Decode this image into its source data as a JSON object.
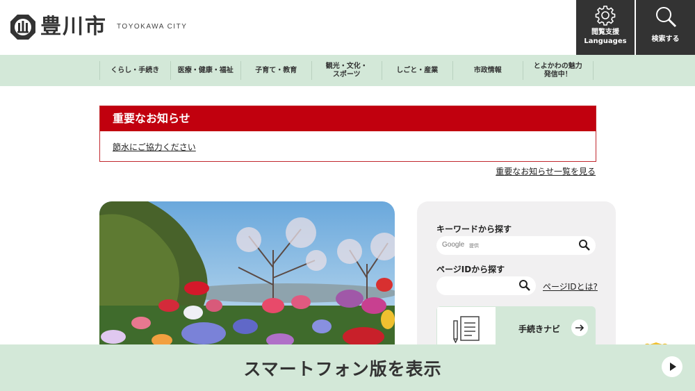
{
  "header": {
    "logo_title": "豊川市",
    "logo_subtitle": "TOYOKAWA CITY",
    "access_label_1": "閲覧支援",
    "access_label_2": "Languages",
    "search_label": "検索する"
  },
  "nav": {
    "items": [
      {
        "line1": "くらし・手続き",
        "line2": ""
      },
      {
        "line1": "医療・健康・福祉",
        "line2": ""
      },
      {
        "line1": "子育て・教育",
        "line2": ""
      },
      {
        "line1": "観光・文化・",
        "line2": "スポーツ"
      },
      {
        "line1": "しごと・産業",
        "line2": ""
      },
      {
        "line1": "市政情報",
        "line2": ""
      },
      {
        "line1": "とよかわの魅力",
        "line2": "発信中！"
      }
    ]
  },
  "notice": {
    "title": "重要なお知らせ",
    "item": "節水にご協力ください",
    "view_all": "重要なお知らせ一覧を見る"
  },
  "search_panel": {
    "keyword_label": "キーワードから探す",
    "keyword_provider": "Google",
    "keyword_provider_suffix": "提供",
    "page_id_label": "ページIDから探す",
    "page_id_help": "ページIDとは?",
    "procedure_label": "手続きナビ"
  },
  "bottom_bar": {
    "label": "スマートフォン版を表示"
  },
  "colors": {
    "accent_green": "#d3e8d8",
    "notice_red": "#c1000e",
    "header_dark": "#333333"
  }
}
